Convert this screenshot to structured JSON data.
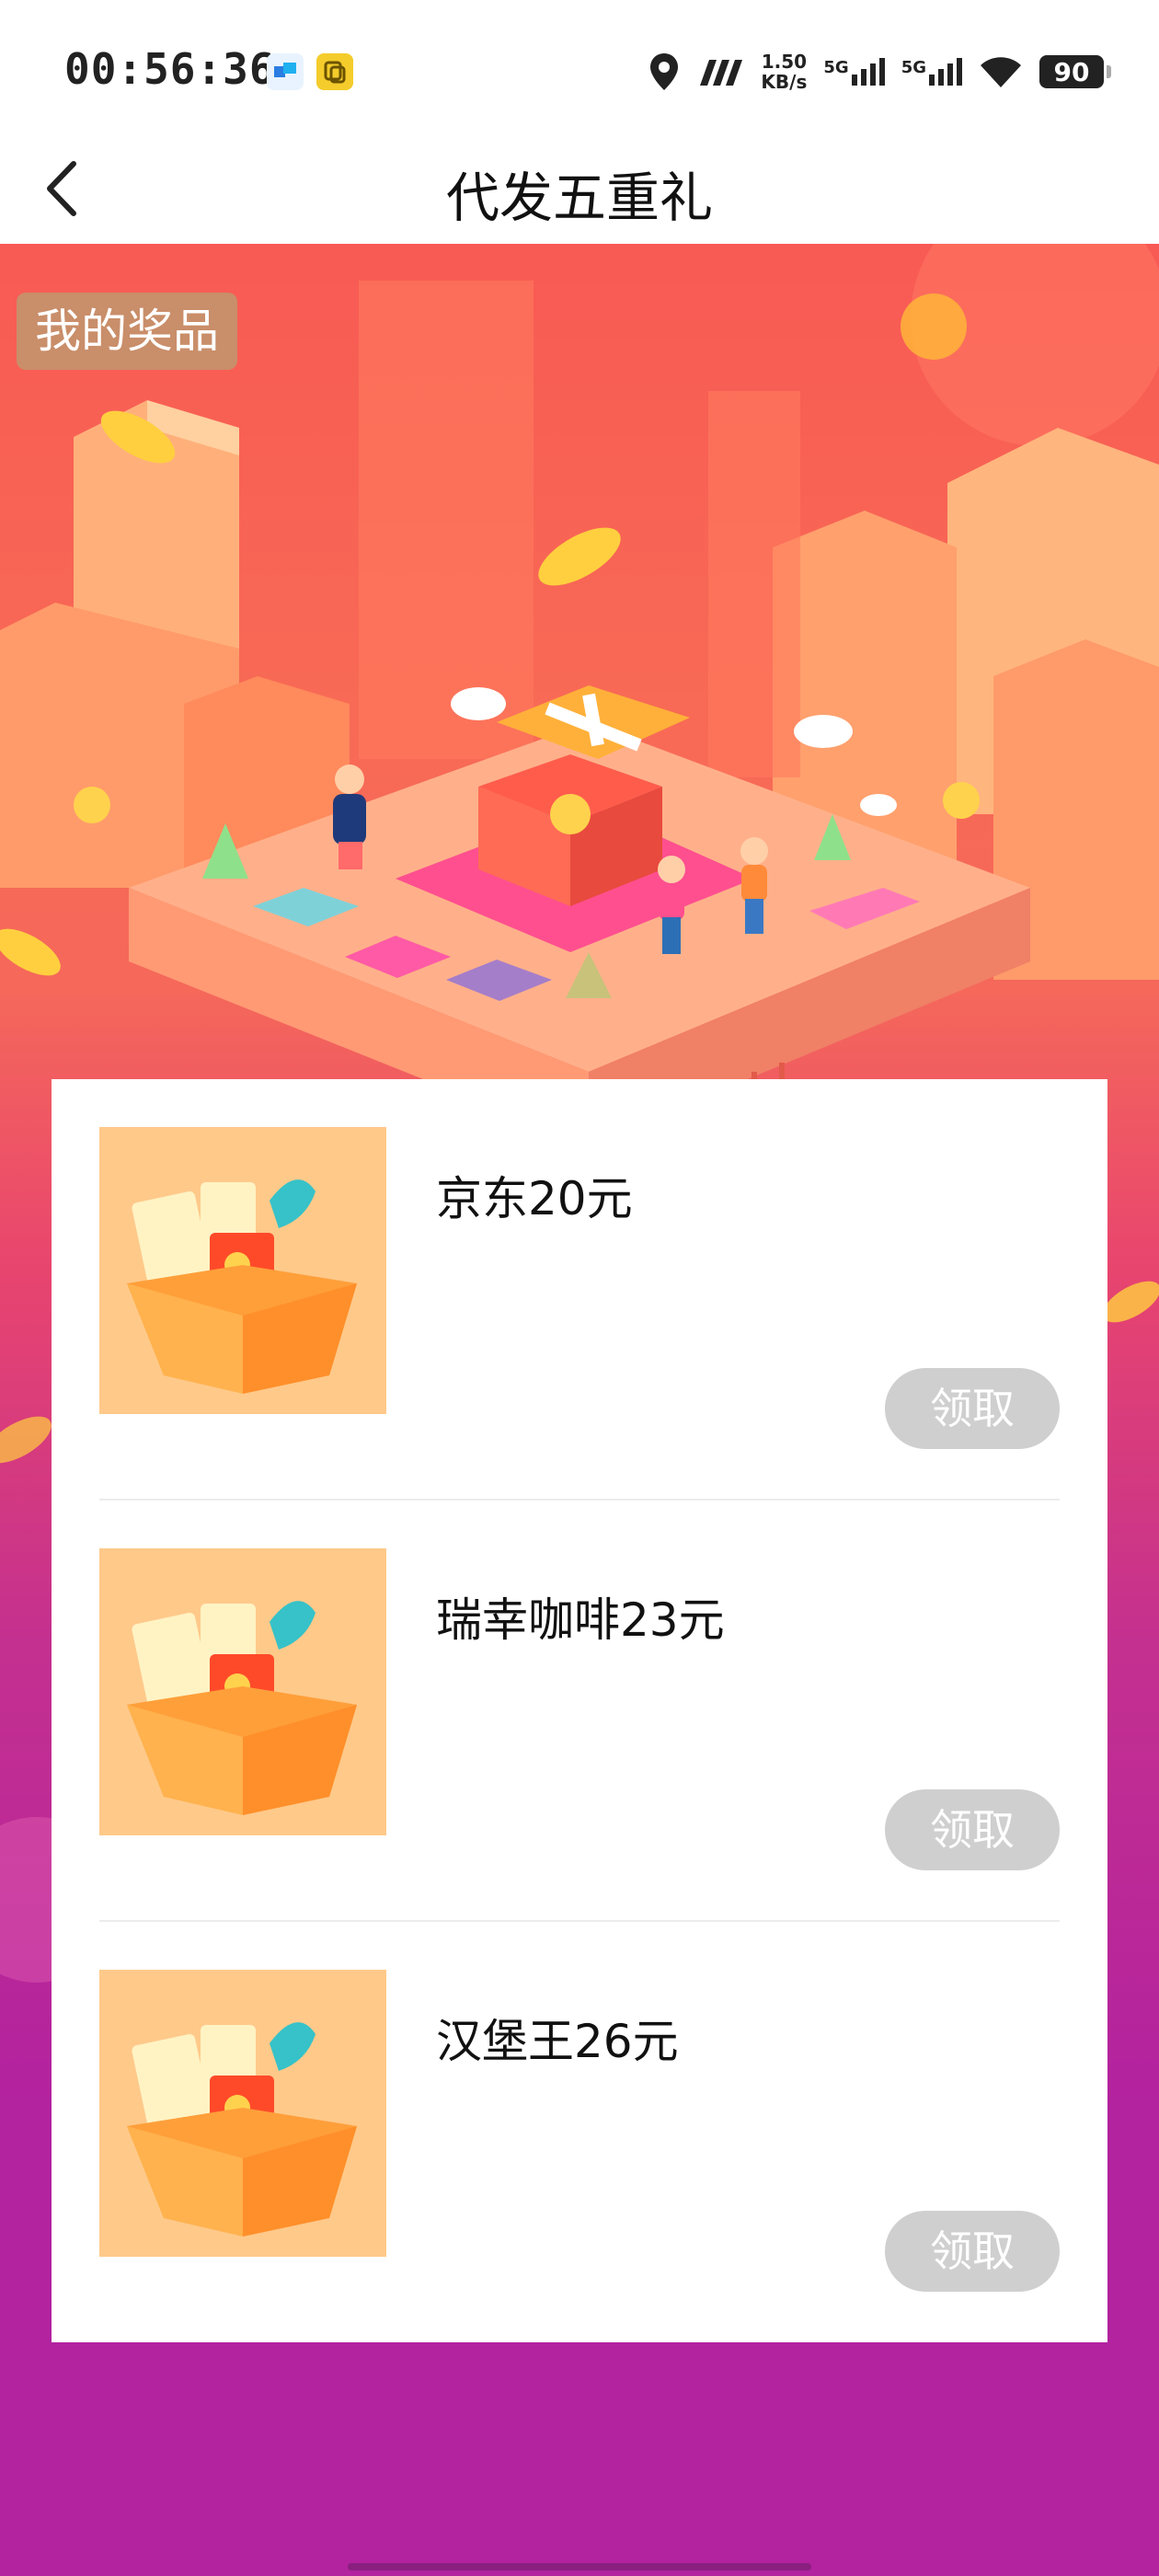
{
  "status_bar": {
    "time": "00:56:36",
    "net_speed_value": "1.50",
    "net_speed_unit": "KB/s",
    "signal1_label": "5G",
    "signal2_label": "5G",
    "battery": "90"
  },
  "nav": {
    "title": "代发五重礼",
    "back_icon": "chevron-left-icon"
  },
  "hero": {
    "prize_tag": "我的奖品"
  },
  "prizes": [
    {
      "name": "京东20元",
      "button": "领取"
    },
    {
      "name": "瑞幸咖啡23元",
      "button": "领取"
    },
    {
      "name": "汉堡王26元",
      "button": "领取"
    }
  ],
  "colors": {
    "hero_top": "#f85a54",
    "hero_bottom": "#b3229f",
    "button_disabled": "#cfcfcf",
    "tag_bg": "#c98e6a"
  }
}
